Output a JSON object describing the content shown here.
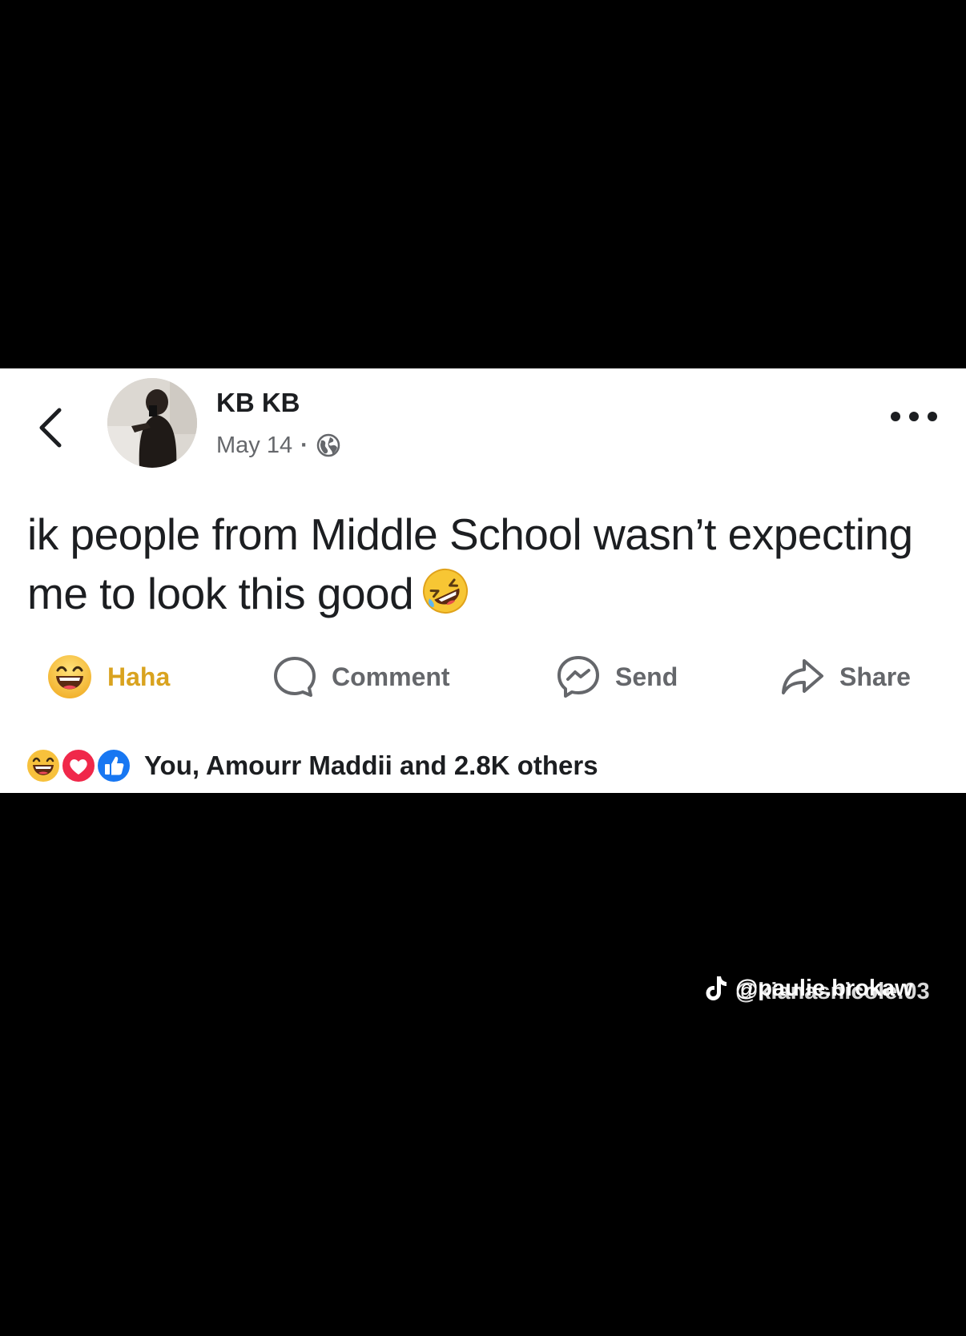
{
  "post": {
    "author": "KB KB",
    "date": "May 14",
    "separator": "·",
    "audience_icon": "globe-icon",
    "text": "ik people from Middle School wasn’t expecting me to look this good",
    "emoji": "rolling-on-the-floor-laughing-emoji"
  },
  "actions": {
    "haha_label": "Haha",
    "comment_label": "Comment",
    "send_label": "Send",
    "share_label": "Share"
  },
  "reactions": {
    "summary": "You, Amourr Maddii and 2.8K others",
    "icons": [
      "haha-reaction-icon",
      "love-reaction-icon",
      "like-reaction-icon"
    ]
  },
  "watermark": {
    "handle_1": "@paulie.brokaw",
    "handle_2": "@kianasnicole.03",
    "icon": "tiktok-logo-icon"
  },
  "colors": {
    "haha": "#d9a31f",
    "love": "#f0284a",
    "like": "#1877f2",
    "muted_text": "#65676b",
    "text": "#1c1e21"
  }
}
